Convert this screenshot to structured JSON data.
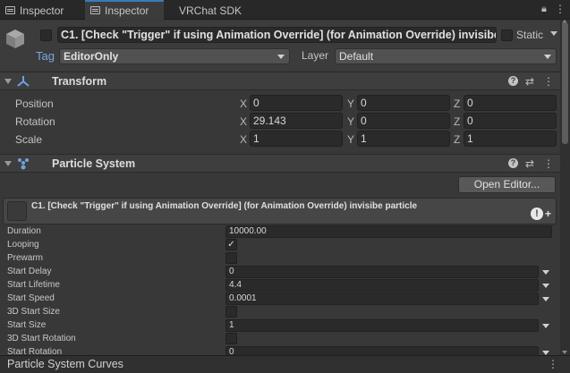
{
  "tabs": [
    {
      "label": "Inspector",
      "icon": "inspector-icon"
    },
    {
      "label": "Inspector",
      "icon": "inspector-icon"
    },
    {
      "label": "VRChat SDK"
    }
  ],
  "tabbar": {
    "lock_icon": "lock-icon",
    "menu_icon": "kebab-menu-icon"
  },
  "object": {
    "name": "C1. [Check \"Trigger\" if using Animation Override] (for Animation Override) invisibe p",
    "static_label": "Static",
    "tag_label": "Tag",
    "tag_value": "EditorOnly",
    "layer_label": "Layer",
    "layer_value": "Default"
  },
  "transform": {
    "title": "Transform",
    "rows": [
      {
        "label": "Position",
        "x": "0",
        "y": "0",
        "z": "0"
      },
      {
        "label": "Rotation",
        "x": "29.143",
        "y": "0",
        "z": "0"
      },
      {
        "label": "Scale",
        "x": "1",
        "y": "1",
        "z": "1"
      }
    ],
    "axis_x": "X",
    "axis_y": "Y",
    "axis_z": "Z"
  },
  "particle_system": {
    "title": "Particle System",
    "open_editor": "Open Editor...",
    "module_title": "C1. [Check \"Trigger\" if using Animation Override] (for Animation Override) invisibe particle",
    "rows": {
      "duration": {
        "label": "Duration",
        "value": "10000.00"
      },
      "looping": {
        "label": "Looping",
        "checked": "✓"
      },
      "prewarm": {
        "label": "Prewarm"
      },
      "start_delay": {
        "label": "Start Delay",
        "value": "0"
      },
      "start_lifetime": {
        "label": "Start Lifetime",
        "value": "4.4"
      },
      "start_speed": {
        "label": "Start Speed",
        "value": "0.0001"
      },
      "start_size_3d": {
        "label": "3D Start Size"
      },
      "start_size": {
        "label": "Start Size",
        "value": "1"
      },
      "start_rotation_3d": {
        "label": "3D Start Rotation"
      },
      "start_rotation": {
        "label": "Start Rotation",
        "value": "0"
      }
    }
  },
  "curves": {
    "title": "Particle System Curves"
  },
  "colors": {
    "accent": "#3a79bb",
    "tag_label": "#79a6e0",
    "panel": "#383838"
  }
}
